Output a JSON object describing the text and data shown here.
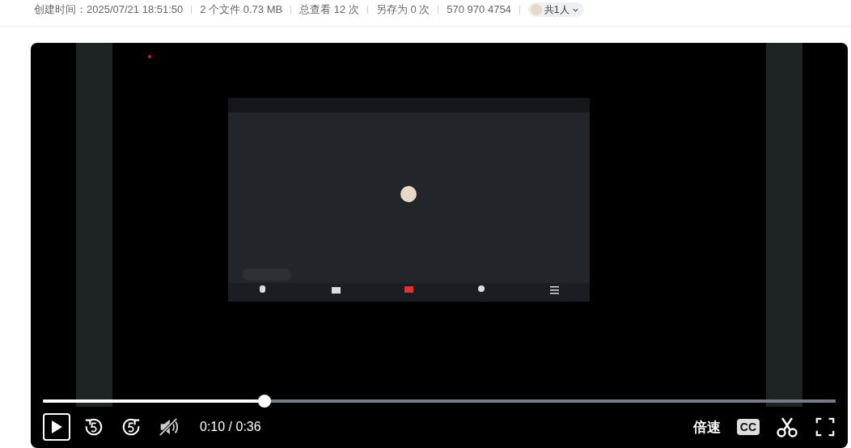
{
  "meta": {
    "items": [
      "创建时间：2025/07/21 18:51:50",
      "2 个文件 0.73 MB",
      "总查看 12 次",
      "另存为 0 次",
      "570 970 4754"
    ],
    "share": "共1人"
  },
  "player": {
    "progress": {
      "level": 0.28
    },
    "time": "0:10 / 0:36",
    "speed": "倍速",
    "captions": "CC"
  }
}
